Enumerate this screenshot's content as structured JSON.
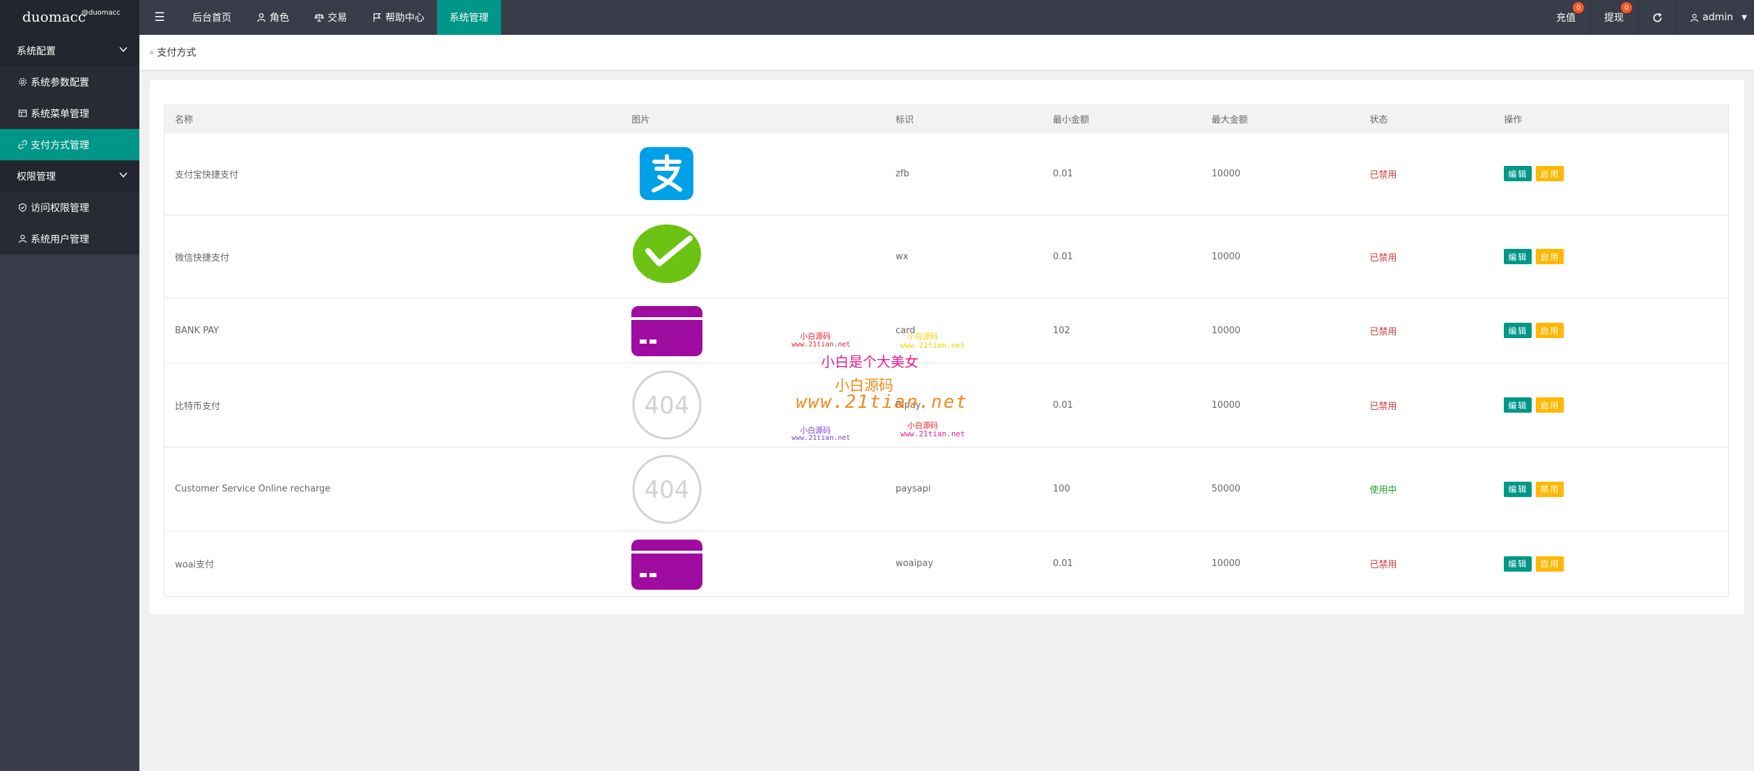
{
  "header": {
    "logo": "duomacc",
    "logo_sup": "@duomacc",
    "nav": [
      {
        "label": "后台首页"
      },
      {
        "label": "角色"
      },
      {
        "label": "交易"
      },
      {
        "label": "帮助中心"
      },
      {
        "label": "系统管理"
      }
    ],
    "right": {
      "recharge": "充值",
      "recharge_badge": "0",
      "withdraw": "提现",
      "withdraw_badge": "0",
      "user": "admin"
    }
  },
  "sidebar": {
    "group1": "系统配置",
    "item1": "系统参数配置",
    "item2": "系统菜单管理",
    "item3": "支付方式管理",
    "group2": "权限管理",
    "item4": "访问权限管理",
    "item5": "系统用户管理"
  },
  "breadcrumb": "支付方式",
  "table": {
    "headers": [
      "名称",
      "图片",
      "标识",
      "最小金额",
      "最大金额",
      "状态",
      "操作"
    ],
    "rows": [
      {
        "name": "支付宝快捷支付",
        "image": "alipay-icon",
        "code": "zfb",
        "min": "0.01",
        "max": "10000",
        "status": "已禁用",
        "status_type": "off",
        "edit": "编辑",
        "toggle": "启用"
      },
      {
        "name": "微信快捷支付",
        "image": "wechat-icon",
        "code": "wx",
        "min": "0.01",
        "max": "10000",
        "status": "已禁用",
        "status_type": "off",
        "edit": "编辑",
        "toggle": "启用"
      },
      {
        "name": "BANK PAY",
        "image": "bank-card-icon",
        "code": "card",
        "min": "102",
        "max": "10000",
        "status": "已禁用",
        "status_type": "off",
        "edit": "编辑",
        "toggle": "启用"
      },
      {
        "name": "比特币支付",
        "image": "not-found-404-icon",
        "code": "Bipay",
        "min": "0.01",
        "max": "10000",
        "status": "已禁用",
        "status_type": "off",
        "edit": "编辑",
        "toggle": "启用"
      },
      {
        "name": "Customer Service Online recharge",
        "image": "not-found-404-icon",
        "code": "paysapi",
        "min": "100",
        "max": "50000",
        "status": "使用中",
        "status_type": "on",
        "edit": "编辑",
        "toggle": "禁用"
      },
      {
        "name": "woai支付",
        "image": "bank-card-icon",
        "code": "woaipay",
        "min": "0.01",
        "max": "10000",
        "status": "已禁用",
        "status_type": "off",
        "edit": "编辑",
        "toggle": "启用"
      }
    ]
  },
  "watermark": {
    "line1": "小白是个大美女",
    "line2": "小白源码",
    "line3": "www.21tian.net",
    "small_a": "小白源码",
    "small_b": "www.21tian.net",
    "small_c": "小白源码",
    "small_d": "www.21tian.net",
    "small_e": "小白源码",
    "small_f": "www.21tian.net",
    "small_g": "小白源码",
    "small_h": "www.21tian.net"
  },
  "colors": {
    "primary": "#009688",
    "warn": "#ffb800",
    "header": "#393d49",
    "sidebar_group": "#23262e",
    "badge": "#ff5722"
  }
}
